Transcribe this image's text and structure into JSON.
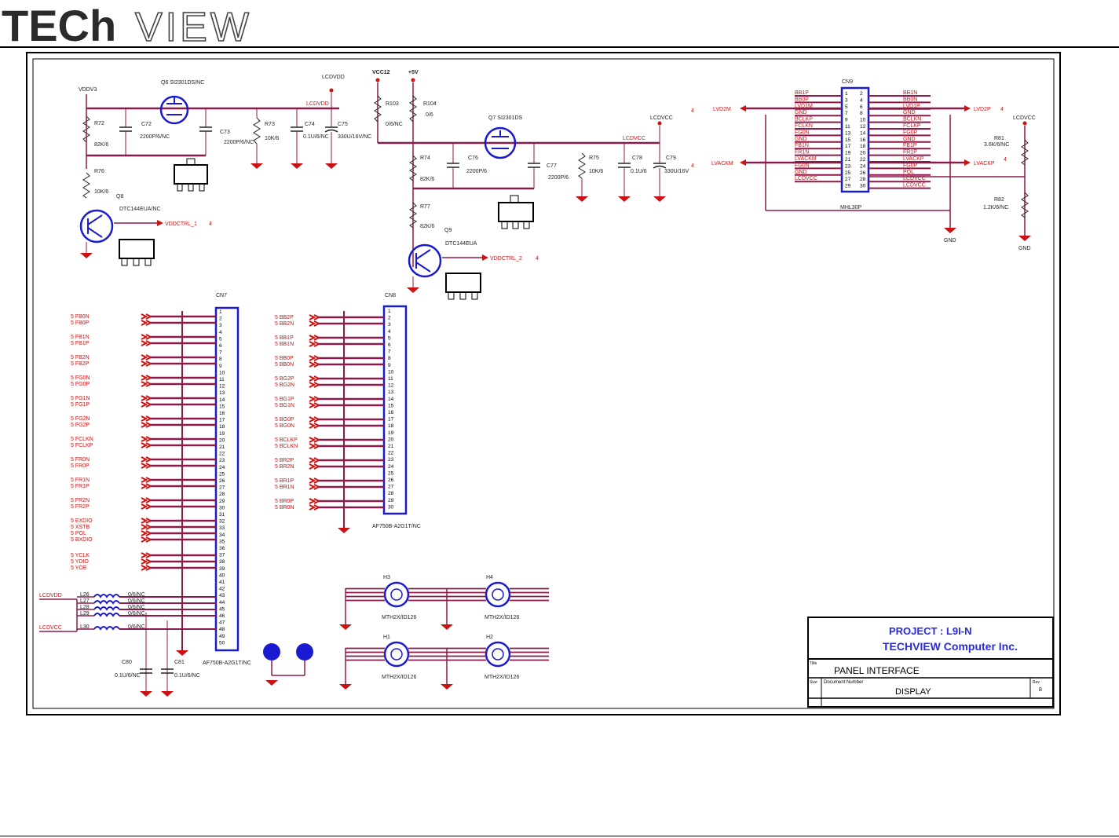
{
  "brand": {
    "logo_text_bold": "TECh",
    "logo_text_outline": "VIEW"
  },
  "title_block": {
    "project": "PROJECT :  L9I-N",
    "company": "TECHVIEW Computer Inc.",
    "title_label": "Title",
    "title": "PANEL INTERFACE",
    "size_label": "Size",
    "size_value": "",
    "docnum_label": "Document Number",
    "docnum": "DISPLAY",
    "rev_label": "Rev",
    "rev_value": "B"
  },
  "power": {
    "vddv3": "VDDV3",
    "lcdvdd": "LCDVDD",
    "vcc12": "VCC12",
    "p5v": "+5V",
    "lcdvcc": "LCDVCC",
    "lcdvcc_r": "LCDVCC"
  },
  "components": {
    "q6": "Q6   SI2301DS/NC",
    "q7": "Q7   SI2301DS",
    "q8": "DTC144EUA/NC",
    "q8_ref": "Q8",
    "q9": "DTC144EUA",
    "q9_ref": "Q9",
    "r72": "R72",
    "r72v": "82K/6",
    "r76": "R76",
    "r76v": "10K/6",
    "c72": "C72",
    "c72v": "2200P/6/NC",
    "c73": "C73",
    "c73v": "2200P/6/NC",
    "r73": "R73",
    "r73v": "10K/6",
    "c74": "C74",
    "c74v": "0.1U/6/NC",
    "c75": "C75",
    "c75v": "330U/16V/NC",
    "r103": "R103",
    "r103v": "0/6/NC",
    "r104": "R104",
    "r104v": "0/6",
    "r74": "R74",
    "r74v": "82K/6",
    "r77": "R77",
    "r77v": "82K/6",
    "c76": "C76",
    "c76v": "2200P/6",
    "c77": "C77",
    "c77v": "2200P/6",
    "r75": "R75",
    "r75v": "10K/6",
    "c78": "C78",
    "c78v": "0.1U/6",
    "c79": "C79",
    "c79v": "330U/16V",
    "r81": "R81",
    "r81v": "3.6K/6/NC",
    "r82": "R82",
    "r82v": "1.2K/6/NC",
    "c80": "C80",
    "c80v": "0.1U/6/NC",
    "c81": "C81",
    "c81v": "0.1U/6/NC",
    "gnd": "GND",
    "vddctrl1": "VDDCTRL_1",
    "vddctrl2": "VDDCTRL_2",
    "lcdvdd_net": "LCDVDD",
    "lcdvcc_net": "LCDVCC"
  },
  "connectors": {
    "cn7": "CN7",
    "cn7_part": "AF750B-A2G1T/NC",
    "cn8": "CN8",
    "cn8_part": "AF750B-A2G1T/NC",
    "cn9": "CN9",
    "cn9_part": "MHL30P",
    "lvd2m": "LVD2M",
    "lvd2p": "LVD2P",
    "lvackm": "LVACKM",
    "lvackp": "LVACKP",
    "sheet_ref": "4"
  },
  "cn7_signals": [
    "FB0N",
    "FB0P",
    "FB1N",
    "FB1P",
    "FB2N",
    "FB2P",
    "FG0N",
    "FG0P",
    "FG1N",
    "FG1P",
    "FG2N",
    "FG2P",
    "FCLKN",
    "FCLKP",
    "FR0N",
    "FR0P",
    "FR1N",
    "FR1P",
    "FR2N",
    "FR2P",
    "EXDIO",
    "XSTB",
    "POL",
    "BXDIO",
    "YCLK",
    "YDIO",
    "YOE"
  ],
  "cn8_signals": [
    "BB2P",
    "BB2N",
    "BB1P",
    "BB1N",
    "BB0P",
    "BB0N",
    "BG2P",
    "BG2N",
    "BG1P",
    "BG1N",
    "BG0P",
    "BG0N",
    "BCLKP",
    "BCLKN",
    "BR2P",
    "BR2N",
    "BR1P",
    "BR1N",
    "BR0P",
    "BR0N"
  ],
  "cn9_left": [
    "BB1P",
    "BB0P",
    "LVD1M",
    "GND",
    "BCLKP",
    "FCLKN",
    "FG0N",
    "GND",
    "FB1N",
    "FR1N",
    "LVACKM",
    "FG0N",
    "GND",
    "LCDVCC"
  ],
  "cn9_right": [
    "BB1N",
    "BB0N",
    "LVD1P",
    "GND",
    "BCLKN",
    "FCLKP",
    "FG0P",
    "GND",
    "FB1P",
    "FR1P",
    "LVACKP",
    "FG0P",
    "POL",
    "LCDVCC",
    "LCDVCC"
  ],
  "mounting_holes": {
    "h1": "H1",
    "h2": "H2",
    "h3": "H3",
    "h4": "H4",
    "part": "MTH2X/ID126"
  },
  "beads": [
    "L26",
    "L27",
    "L28",
    "L29",
    "L30"
  ],
  "bead_values": [
    "0/6/NC",
    "0/6/NC",
    "0/6/NC",
    "0/6/NC",
    "0/6/NC"
  ],
  "colors": {
    "wire": "#8b1a4a",
    "label": "#cc1111",
    "component": "#1a1ad0",
    "ground": "#cc1111",
    "frame": "#000000"
  }
}
